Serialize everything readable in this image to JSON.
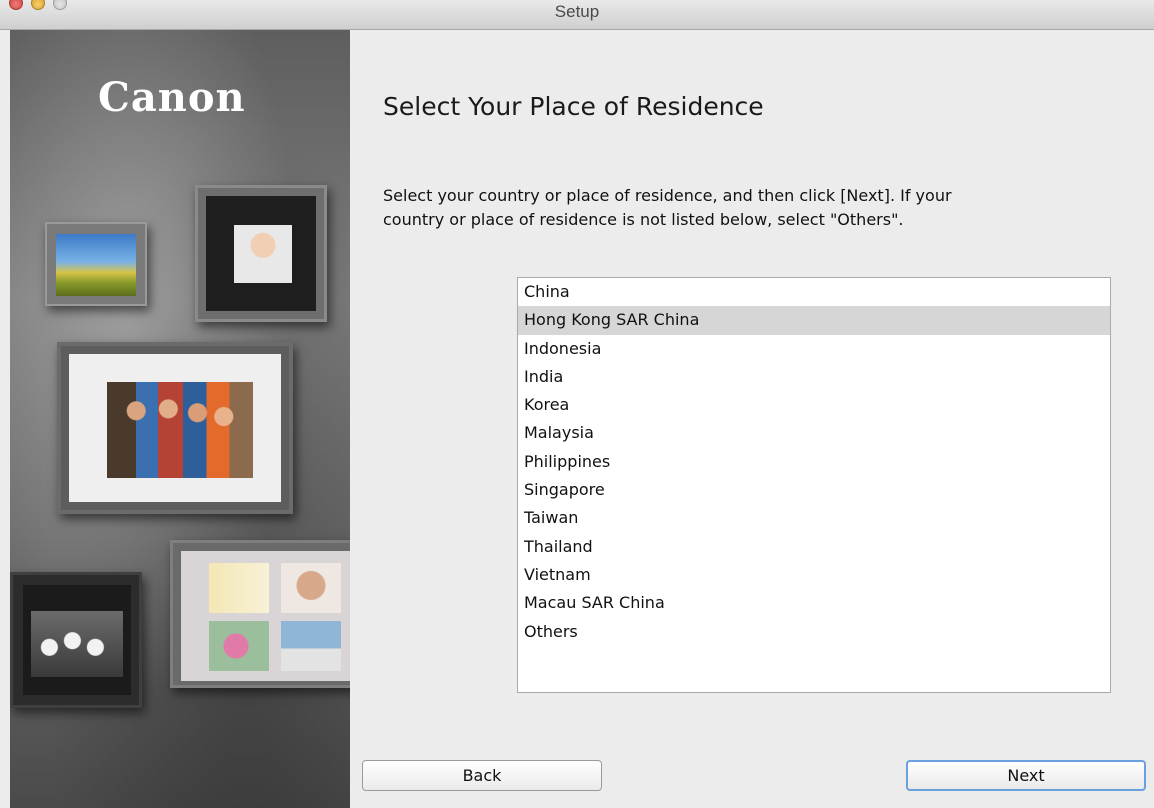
{
  "window": {
    "title": "Setup"
  },
  "brand": {
    "logo_text": "Canon"
  },
  "page": {
    "heading": "Select Your Place of Residence",
    "description_line1": "Select your country or place of residence, and then click [Next]. If your",
    "description_line2": "country or place of residence is not listed below, select \"Others\"."
  },
  "countries": {
    "selected_index": 1,
    "items": [
      "China",
      "Hong Kong SAR China",
      "Indonesia",
      "India",
      "Korea",
      "Malaysia",
      "Philippines",
      "Singapore",
      "Taiwan",
      "Thailand",
      "Vietnam",
      "Macau SAR China",
      "Others"
    ]
  },
  "buttons": {
    "back_label": "Back",
    "next_label": "Next"
  },
  "colors": {
    "selection_bg": "#d6d6d6",
    "default_button_border": "#6aa0e0",
    "window_bg": "#ececec"
  }
}
